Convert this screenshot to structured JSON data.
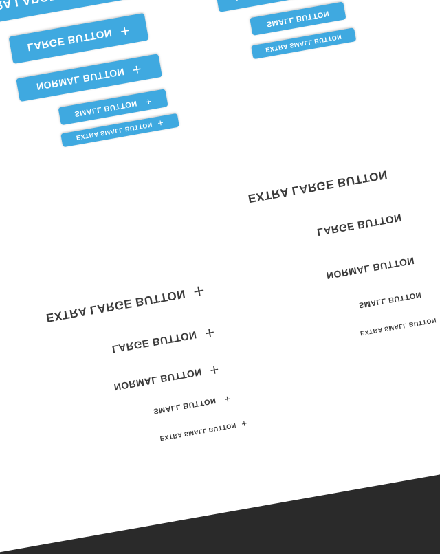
{
  "colors": {
    "accent": "#3fa9e0",
    "background": "#ffffff",
    "frame": "#2a2a2a",
    "flat_text": "#3a3a3a"
  },
  "icons": {
    "plus": "+"
  },
  "buttons": {
    "extra_large": "EXTRA LARGE BUTTON",
    "large": "LARGE BUTTON",
    "normal": "NORMAL BUTTON",
    "small": "SMALL BUTTON",
    "extra_small": "EXTRA SMALL BUTTON"
  }
}
